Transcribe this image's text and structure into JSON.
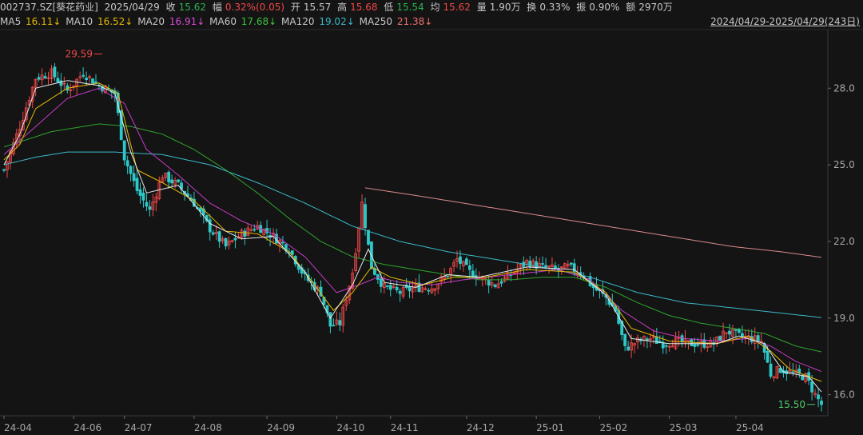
{
  "header": {
    "code": "002737.SZ[葵花药业]",
    "date": "2025/04/29",
    "close_label": "收",
    "close": "15.62",
    "chg_label": "幅",
    "chg": "0.32%(0.05)",
    "open_label": "开",
    "open": "15.57",
    "high_label": "高",
    "high": "15.68",
    "low_label": "低",
    "low": "15.54",
    "avg_label": "均",
    "avg": "15.62",
    "vol_label": "量",
    "vol": "1.90万",
    "turn_label": "换",
    "turn": "0.33%",
    "amp_label": "振",
    "amp": "0.90%",
    "amt_label": "额",
    "amt": "2970万"
  },
  "ma_bar": {
    "ma5_label": "MA5",
    "ma5": "16.11↓",
    "ma10_label": "MA10",
    "ma10": "16.52↓",
    "ma20_label": "MA20",
    "ma20": "16.91↓",
    "ma60_label": "MA60",
    "ma60": "17.68↓",
    "ma120_label": "MA120",
    "ma120": "19.02↓",
    "ma250_label": "MA250",
    "ma250": "21.38↓",
    "range": "2024/04/29-2025/04/29(243日)"
  },
  "colors": {
    "up": "#f04848",
    "down": "#2ec8c8",
    "ma5": "#e8e8e8",
    "ma10": "#e6b800",
    "ma20": "#c33bc3",
    "ma60": "#2fa52f",
    "ma120": "#3ab8c8",
    "ma250": "#d98a8a"
  },
  "chart_data": {
    "type": "candlestick",
    "ylim": [
      15.3,
      30.2
    ],
    "y_ticks": [
      "28.0",
      "25.0",
      "22.0",
      "19.0",
      "16.0"
    ],
    "y_tick_values": [
      28.0,
      25.0,
      22.0,
      19.0,
      16.0
    ],
    "x_ticks": [
      "24-04",
      "24-06",
      "24-07",
      "24-08",
      "24-09",
      "24-10",
      "24-11",
      "24-12",
      "25-01",
      "25-02",
      "25-03",
      "25-04"
    ],
    "max_label": "29.59",
    "min_label": "15.50",
    "close_anchors": [
      [
        0,
        24.8
      ],
      [
        5,
        26.5
      ],
      [
        10,
        28.4
      ],
      [
        15,
        28.6
      ],
      [
        20,
        27.9
      ],
      [
        25,
        28.6
      ],
      [
        30,
        28.1
      ],
      [
        35,
        27.8
      ],
      [
        38,
        25.3
      ],
      [
        42,
        24.0
      ],
      [
        46,
        23.2
      ],
      [
        50,
        24.6
      ],
      [
        55,
        24.2
      ],
      [
        60,
        23.5
      ],
      [
        65,
        22.5
      ],
      [
        70,
        21.8
      ],
      [
        75,
        22.3
      ],
      [
        80,
        22.6
      ],
      [
        85,
        22.2
      ],
      [
        90,
        21.7
      ],
      [
        95,
        20.6
      ],
      [
        100,
        20.0
      ],
      [
        103,
        18.7
      ],
      [
        106,
        18.8
      ],
      [
        110,
        20.8
      ],
      [
        113,
        23.5
      ],
      [
        116,
        21.0
      ],
      [
        120,
        20.2
      ],
      [
        125,
        20.0
      ],
      [
        130,
        20.2
      ],
      [
        135,
        20.2
      ],
      [
        140,
        20.7
      ],
      [
        143,
        21.3
      ],
      [
        147,
        20.8
      ],
      [
        150,
        20.6
      ],
      [
        155,
        20.3
      ],
      [
        160,
        20.7
      ],
      [
        165,
        21.2
      ],
      [
        170,
        21.0
      ],
      [
        175,
        20.9
      ],
      [
        178,
        21.0
      ],
      [
        182,
        20.8
      ],
      [
        186,
        20.2
      ],
      [
        190,
        19.8
      ],
      [
        193,
        19.3
      ],
      [
        196,
        17.8
      ],
      [
        200,
        18.1
      ],
      [
        204,
        18.2
      ],
      [
        208,
        18.0
      ],
      [
        212,
        18.1
      ],
      [
        216,
        18.0
      ],
      [
        220,
        18.0
      ],
      [
        224,
        18.0
      ],
      [
        228,
        18.5
      ],
      [
        232,
        18.3
      ],
      [
        236,
        18.2
      ],
      [
        239,
        18.1
      ],
      [
        242,
        16.8
      ],
      [
        245,
        17.0
      ],
      [
        250,
        16.8
      ],
      [
        253,
        16.7
      ],
      [
        256,
        16.0
      ],
      [
        258,
        15.62
      ]
    ],
    "ma5": [
      [
        0,
        25.0
      ],
      [
        5,
        26.2
      ],
      [
        10,
        28.0
      ],
      [
        20,
        28.3
      ],
      [
        30,
        28.1
      ],
      [
        35,
        27.8
      ],
      [
        40,
        25.5
      ],
      [
        45,
        23.9
      ],
      [
        55,
        24.2
      ],
      [
        65,
        22.7
      ],
      [
        75,
        22.1
      ],
      [
        85,
        22.2
      ],
      [
        95,
        20.8
      ],
      [
        103,
        19.0
      ],
      [
        110,
        20.3
      ],
      [
        115,
        21.7
      ],
      [
        120,
        20.4
      ],
      [
        130,
        20.2
      ],
      [
        140,
        20.7
      ],
      [
        150,
        20.6
      ],
      [
        165,
        21.0
      ],
      [
        180,
        20.9
      ],
      [
        190,
        19.9
      ],
      [
        198,
        18.2
      ],
      [
        210,
        18.0
      ],
      [
        225,
        18.0
      ],
      [
        232,
        18.3
      ],
      [
        240,
        18.0
      ],
      [
        246,
        16.9
      ],
      [
        254,
        16.7
      ],
      [
        258,
        16.11
      ]
    ],
    "ma10": [
      [
        0,
        25.2
      ],
      [
        5,
        25.8
      ],
      [
        10,
        27.2
      ],
      [
        20,
        28.0
      ],
      [
        30,
        28.2
      ],
      [
        36,
        27.8
      ],
      [
        42,
        24.8
      ],
      [
        50,
        24.3
      ],
      [
        60,
        23.6
      ],
      [
        70,
        22.4
      ],
      [
        80,
        22.3
      ],
      [
        90,
        21.6
      ],
      [
        98,
        20.3
      ],
      [
        104,
        19.3
      ],
      [
        110,
        20.0
      ],
      [
        116,
        21.0
      ],
      [
        122,
        20.6
      ],
      [
        132,
        20.3
      ],
      [
        142,
        20.6
      ],
      [
        152,
        20.6
      ],
      [
        165,
        20.9
      ],
      [
        180,
        20.8
      ],
      [
        190,
        20.0
      ],
      [
        198,
        18.6
      ],
      [
        210,
        18.1
      ],
      [
        225,
        18.0
      ],
      [
        235,
        18.3
      ],
      [
        242,
        17.7
      ],
      [
        248,
        17.0
      ],
      [
        258,
        16.52
      ]
    ],
    "ma20": [
      [
        0,
        25.4
      ],
      [
        10,
        26.5
      ],
      [
        20,
        27.6
      ],
      [
        30,
        28.0
      ],
      [
        38,
        27.4
      ],
      [
        45,
        25.6
      ],
      [
        55,
        24.6
      ],
      [
        65,
        23.5
      ],
      [
        75,
        22.8
      ],
      [
        85,
        22.3
      ],
      [
        95,
        21.4
      ],
      [
        105,
        20.0
      ],
      [
        112,
        20.3
      ],
      [
        118,
        20.6
      ],
      [
        125,
        20.4
      ],
      [
        135,
        20.3
      ],
      [
        145,
        20.5
      ],
      [
        160,
        20.7
      ],
      [
        175,
        20.9
      ],
      [
        185,
        20.5
      ],
      [
        195,
        19.3
      ],
      [
        205,
        18.5
      ],
      [
        215,
        18.2
      ],
      [
        225,
        18.1
      ],
      [
        235,
        18.2
      ],
      [
        242,
        17.9
      ],
      [
        250,
        17.3
      ],
      [
        258,
        16.91
      ]
    ],
    "ma60": [
      [
        0,
        25.7
      ],
      [
        15,
        26.3
      ],
      [
        30,
        26.6
      ],
      [
        40,
        26.5
      ],
      [
        50,
        26.2
      ],
      [
        60,
        25.6
      ],
      [
        70,
        24.8
      ],
      [
        80,
        23.9
      ],
      [
        90,
        22.9
      ],
      [
        100,
        22.0
      ],
      [
        110,
        21.4
      ],
      [
        120,
        21.1
      ],
      [
        130,
        20.9
      ],
      [
        140,
        20.7
      ],
      [
        150,
        20.5
      ],
      [
        160,
        20.5
      ],
      [
        170,
        20.6
      ],
      [
        180,
        20.6
      ],
      [
        190,
        20.2
      ],
      [
        200,
        19.6
      ],
      [
        210,
        19.1
      ],
      [
        220,
        18.8
      ],
      [
        230,
        18.6
      ],
      [
        240,
        18.4
      ],
      [
        250,
        17.9
      ],
      [
        258,
        17.68
      ]
    ],
    "ma120": [
      [
        0,
        25.0
      ],
      [
        10,
        25.3
      ],
      [
        20,
        25.5
      ],
      [
        35,
        25.5
      ],
      [
        50,
        25.4
      ],
      [
        65,
        25.0
      ],
      [
        80,
        24.3
      ],
      [
        95,
        23.5
      ],
      [
        110,
        22.6
      ],
      [
        125,
        22.0
      ],
      [
        140,
        21.6
      ],
      [
        155,
        21.3
      ],
      [
        170,
        21.0
      ],
      [
        185,
        20.6
      ],
      [
        200,
        20.0
      ],
      [
        215,
        19.6
      ],
      [
        230,
        19.4
      ],
      [
        245,
        19.2
      ],
      [
        258,
        19.02
      ]
    ],
    "ma250": [
      [
        114,
        24.1
      ],
      [
        130,
        23.8
      ],
      [
        150,
        23.4
      ],
      [
        170,
        23.0
      ],
      [
        190,
        22.6
      ],
      [
        210,
        22.2
      ],
      [
        230,
        21.8
      ],
      [
        245,
        21.6
      ],
      [
        258,
        21.38
      ]
    ]
  }
}
